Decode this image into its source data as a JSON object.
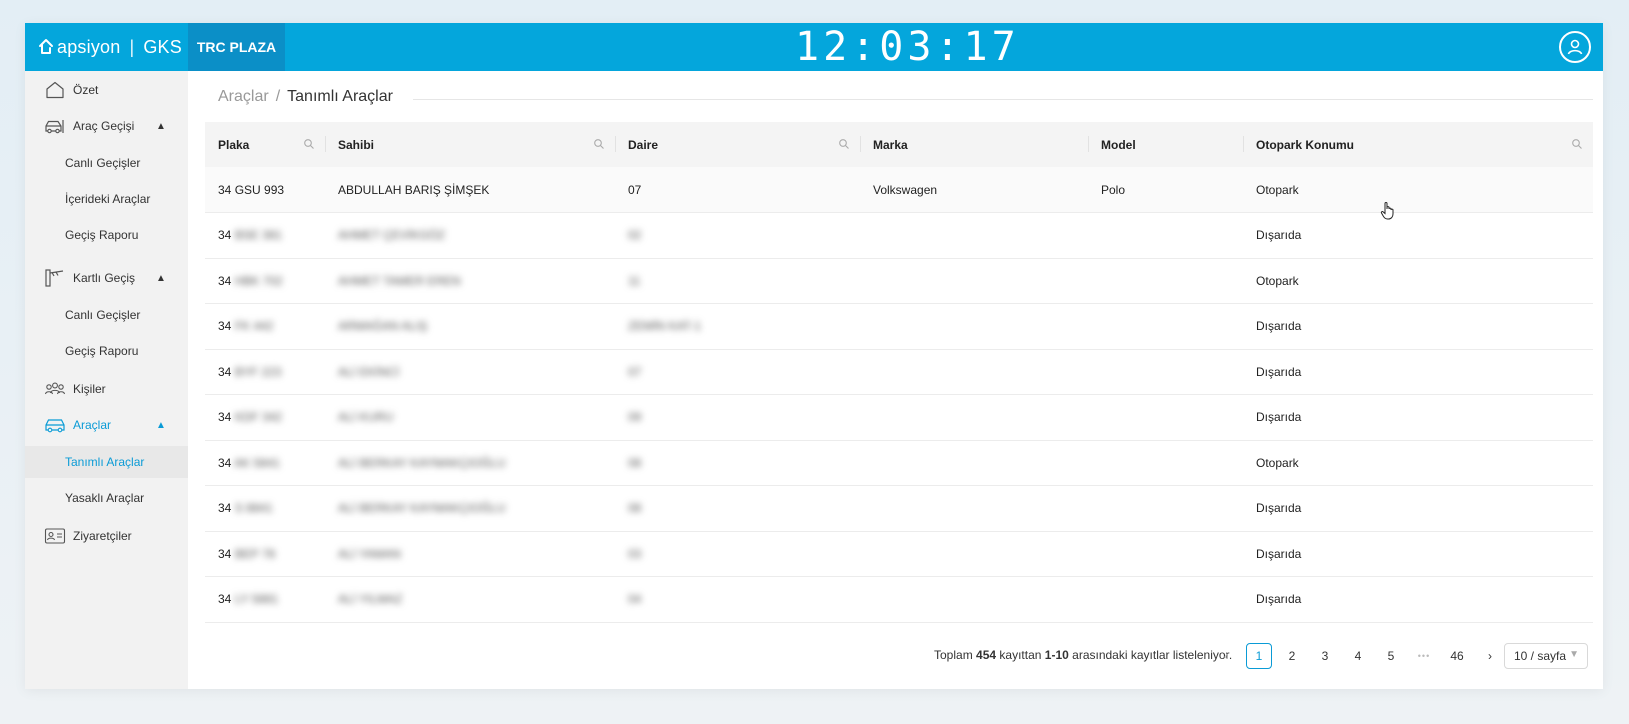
{
  "header": {
    "brand_left": "apsiyon",
    "brand_sep": "|",
    "brand_right": "GKS",
    "site": "TRC PLAZA",
    "clock": "12:03:17"
  },
  "sidebar": {
    "items": [
      {
        "label": "Özet",
        "icon": "home-icon"
      },
      {
        "label": "Araç Geçişi",
        "icon": "car-gate-icon",
        "expanded": true
      },
      {
        "label": "Kartlı Geçiş",
        "icon": "barrier-icon",
        "expanded": true
      },
      {
        "label": "Kişiler",
        "icon": "people-icon"
      },
      {
        "label": "Araçlar",
        "icon": "car-icon",
        "expanded": true,
        "active": true
      },
      {
        "label": "Ziyaretçiler",
        "icon": "visitor-card-icon"
      }
    ],
    "arac_gecisi_sub": [
      "Canlı Geçişler",
      "İçerideki Araçlar",
      "Geçiş Raporu"
    ],
    "kartli_gecis_sub": [
      "Canlı Geçişler",
      "Geçiş Raporu"
    ],
    "araclar_sub": [
      "Tanımlı Araçlar",
      "Yasaklı Araçlar"
    ],
    "active_color": "#0a9bd6"
  },
  "breadcrumb": {
    "parent": "Araçlar",
    "sep": "/",
    "current": "Tanımlı Araçlar"
  },
  "table": {
    "columns": [
      "Plaka",
      "Sahibi",
      "Daire",
      "Marka",
      "Model",
      "Otopark Konumu"
    ],
    "rows": [
      {
        "plate_prefix": "34",
        "plate_rest": "GSU 993",
        "owner": "ABDULLAH BARIŞ ŞİMŞEK",
        "daire": "07",
        "marka": "Volkswagen",
        "model": "Polo",
        "konum": "Otopark",
        "blurred": false
      },
      {
        "plate_prefix": "34",
        "plate_rest": "BSE 381",
        "owner": "AHMET ÇEVİKGÖZ",
        "daire": "02",
        "marka": "",
        "model": "",
        "konum": "Dışarıda",
        "blurred": true
      },
      {
        "plate_prefix": "34",
        "plate_rest": "HBK 702",
        "owner": "AHMET TAMER EREN",
        "daire": "11",
        "marka": "",
        "model": "",
        "konum": "Otopark",
        "blurred": true
      },
      {
        "plate_prefix": "34",
        "plate_rest": "FK 442",
        "owner": "ARMAĞAN ALIŞ",
        "daire": "ZEMİN KAT-1",
        "marka": "",
        "model": "",
        "konum": "Dışarıda",
        "blurred": true
      },
      {
        "plate_prefix": "34",
        "plate_rest": "BYF 223",
        "owner": "ALİ EKİNCİ",
        "daire": "07",
        "marka": "",
        "model": "",
        "konum": "Dışarıda",
        "blurred": true
      },
      {
        "plate_prefix": "34",
        "plate_rest": "KDF 342",
        "owner": "ALİ KURU",
        "daire": "09",
        "marka": "",
        "model": "",
        "konum": "Dışarıda",
        "blurred": true
      },
      {
        "plate_prefix": "34",
        "plate_rest": "AK 5841",
        "owner": "ALİ BERKAY KAYMAKÇIOĞLU",
        "daire": "08",
        "marka": "",
        "model": "",
        "konum": "Otopark",
        "blurred": true
      },
      {
        "plate_prefix": "34",
        "plate_rest": "S 8841",
        "owner": "ALİ BERKAY KAYMAKÇIOĞLU",
        "daire": "08",
        "marka": "",
        "model": "",
        "konum": "Dışarıda",
        "blurred": true
      },
      {
        "plate_prefix": "34",
        "plate_rest": "BEP 78",
        "owner": "ALİ YAMAN",
        "daire": "03",
        "marka": "",
        "model": "",
        "konum": "Dışarıda",
        "blurred": true
      },
      {
        "plate_prefix": "34",
        "plate_rest": "LY 5881",
        "owner": "ALİ YILMAZ",
        "daire": "04",
        "marka": "",
        "model": "",
        "konum": "Dışarıda",
        "blurred": true
      }
    ]
  },
  "footer": {
    "total_pre": "Toplam",
    "total_count": "454",
    "total_mid": "kayıttan",
    "range": "1-10",
    "total_post": "arasındaki kayıtlar listeleniyor.",
    "pages": [
      "1",
      "2",
      "3",
      "4",
      "5",
      "46"
    ],
    "ellipsis": "•••",
    "current_page": "1",
    "page_size": "10 / sayfa"
  }
}
